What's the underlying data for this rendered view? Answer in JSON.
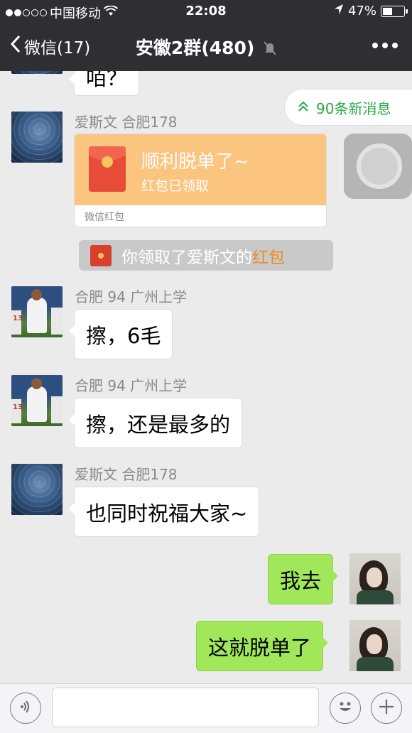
{
  "status_bar": {
    "carrier": "中国移动",
    "time": "22:08",
    "battery": "47%",
    "battery_level": 0.47
  },
  "nav": {
    "back_label": "微信(17)",
    "title": "安徽2群(480)"
  },
  "new_messages": "90条新消息",
  "messages": [
    {
      "text": "咟？"
    },
    {
      "sender": "爱斯文 合肥178"
    },
    {
      "sender": "合肥 94 广州上学",
      "text": "擦，6毛"
    },
    {
      "sender": "合肥 94 广州上学",
      "text": "擦，还是最多的"
    },
    {
      "sender": "爱斯文 合肥178",
      "text": "也同时祝福大家~"
    },
    {
      "text": "我去"
    },
    {
      "text": "这就脱单了"
    }
  ],
  "red_packet": {
    "title": "顺利脱单了~",
    "status": "红包已领取",
    "footer": "微信红包"
  },
  "notice": {
    "prefix": "你领取了爱斯文的",
    "highlight": "红包"
  },
  "colors": {
    "nav_bg": "#2f2f33",
    "chat_bg": "#ebebeb",
    "my_bubble": "#a0e75a",
    "red_packet": "#fbc47f",
    "accent_green": "#2aa745"
  },
  "icons": [
    "signal-dots-icon",
    "wifi-icon",
    "location-arrow-icon",
    "battery-icon",
    "back-chevron-icon",
    "mute-icon",
    "more-icon",
    "double-chevron-up-icon",
    "red-packet-icon",
    "voice-icon",
    "emoji-icon",
    "plus-icon"
  ]
}
